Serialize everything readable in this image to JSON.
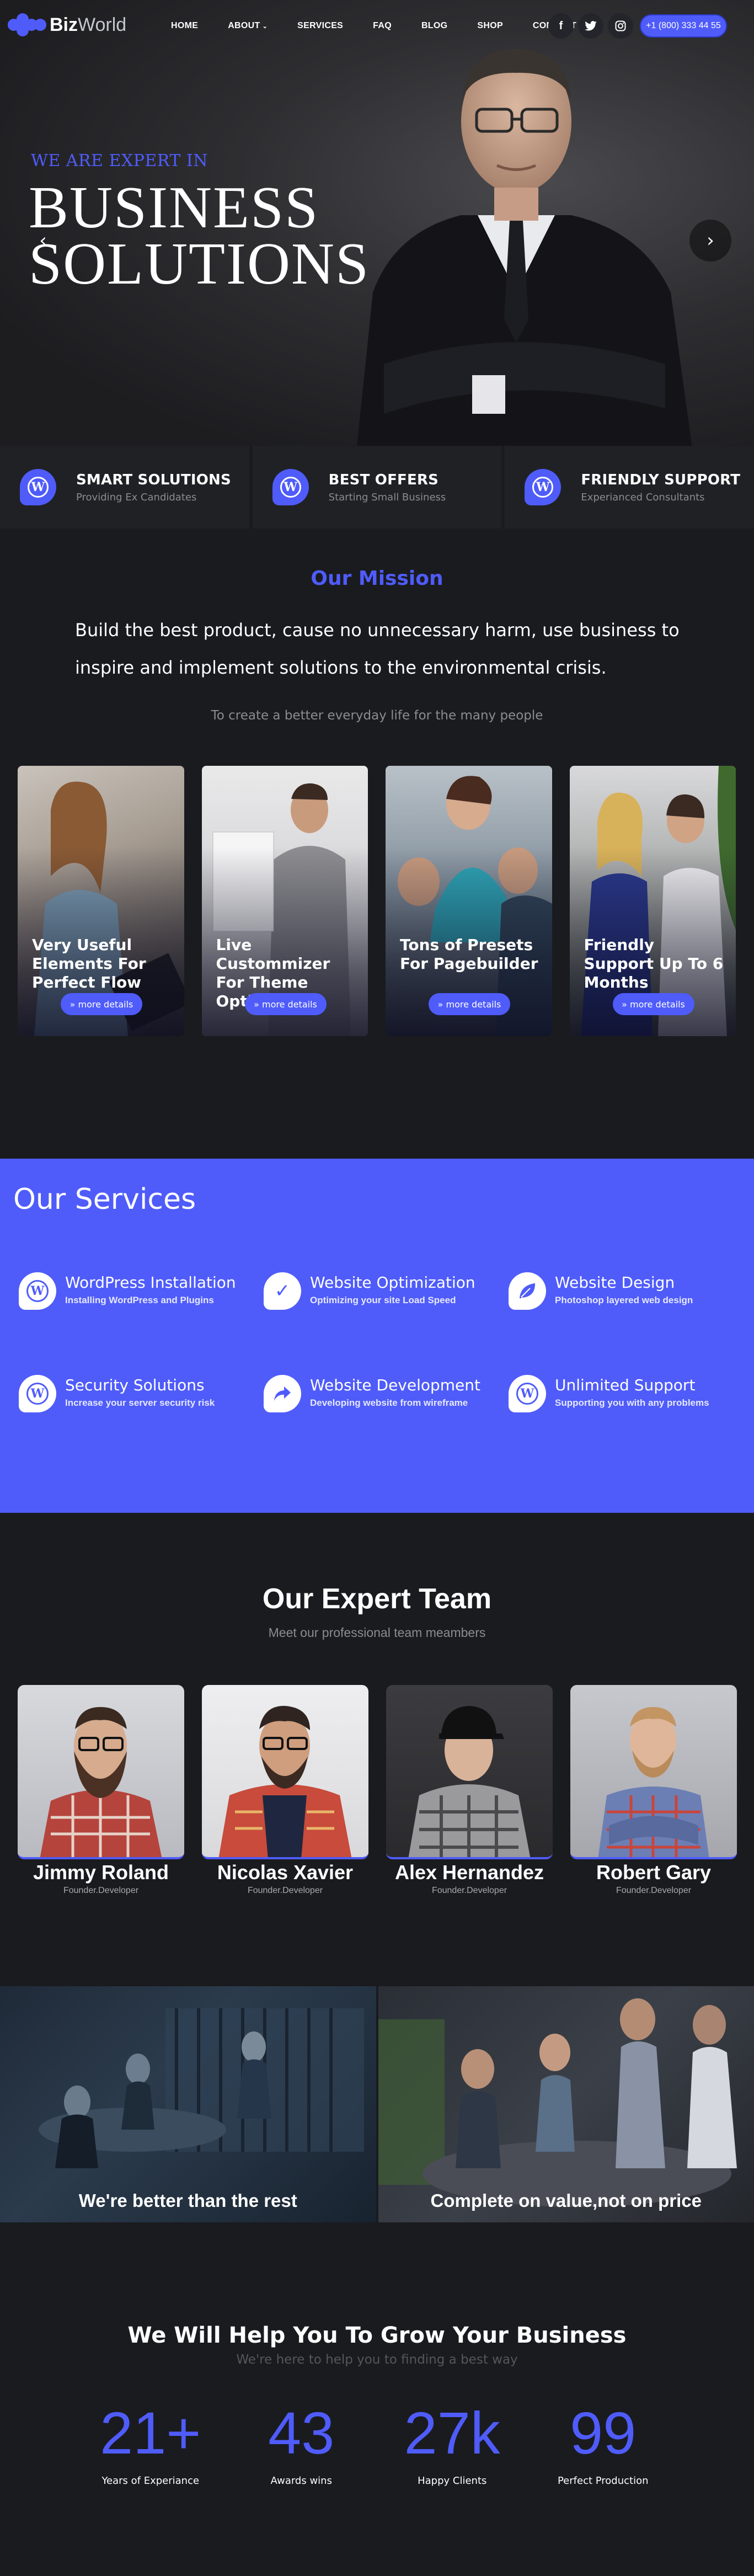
{
  "brand": {
    "name_bold": "Biz",
    "name_light": "World",
    "accent_color": "#4f5cfa"
  },
  "nav": {
    "items": [
      {
        "label": "HOME"
      },
      {
        "label": "ABOUT",
        "has_dropdown": true
      },
      {
        "label": "SERVICES"
      },
      {
        "label": "FAQ"
      },
      {
        "label": "BLOG"
      },
      {
        "label": "SHOP"
      },
      {
        "label": "CONTACT"
      }
    ],
    "social": [
      {
        "icon": "facebook-icon",
        "glyph": "f"
      },
      {
        "icon": "twitter-icon",
        "glyph": "🐦"
      },
      {
        "icon": "instagram-icon",
        "glyph": "◎"
      }
    ],
    "phone": "+1 (800) 333 44 55"
  },
  "hero": {
    "kicker": "WE ARE EXPERT IN",
    "title_line1": "BUSINESS",
    "title_line2": "SOLUTIONS",
    "prev_arrow": "‹",
    "next_arrow": "›"
  },
  "features": [
    {
      "title": "SMART SOLUTIONS",
      "subtitle": "Providing Ex Candidates",
      "icon": "wordpress-icon"
    },
    {
      "title": "BEST OFFERS",
      "subtitle": "Starting Small Business",
      "icon": "wordpress-icon"
    },
    {
      "title": "FRIENDLY SUPPORT",
      "subtitle": "Experianced Consultants",
      "icon": "wordpress-icon"
    }
  ],
  "mission": {
    "title": "Our Mission",
    "text": "Build the best product, cause no unnecessary harm, use business to inspire and implement solutions to the environmental crisis.",
    "subtitle": "To create a better everyday life for the many people"
  },
  "cards": [
    {
      "title": "Very Useful Elements For Perfect Flow",
      "button": "» more details"
    },
    {
      "title": "Live Custommizer For Theme Option",
      "button": "» more details"
    },
    {
      "title": "Tons of Presets For Pagebuilder",
      "button": "» more details"
    },
    {
      "title": "Friendly Support Up To 6 Months",
      "button": "» more details"
    }
  ],
  "services": {
    "title": "Our Services",
    "items": [
      {
        "title": "WordPress Installation",
        "subtitle": "Installing WordPress and Plugins",
        "icon": "wordpress-icon"
      },
      {
        "title": "Website Optimization",
        "subtitle": "Optimizing your site Load Speed",
        "icon": "check-icon"
      },
      {
        "title": "Website Design",
        "subtitle": "Photoshop layered web design",
        "icon": "leaf-icon"
      },
      {
        "title": "Security Solutions",
        "subtitle": "Increase your server security risk",
        "icon": "wordpress-icon"
      },
      {
        "title": "Website Development",
        "subtitle": "Developing website from wireframe",
        "icon": "share-arrow-icon"
      },
      {
        "title": "Unlimited Support",
        "subtitle": "Supporting you with any problems",
        "icon": "wordpress-icon"
      }
    ]
  },
  "team": {
    "title": "Our Expert Team",
    "subtitle": "Meet our professional team meambers",
    "members": [
      {
        "name": "Jimmy Roland",
        "role": "Founder.Developer"
      },
      {
        "name": "Nicolas Xavier",
        "role": "Founder.Developer"
      },
      {
        "name": "Alex Hernandez",
        "role": "Founder.Developer"
      },
      {
        "name": "Robert Gary",
        "role": "Founder.Developer"
      }
    ]
  },
  "banners": [
    {
      "title": "We're better than the rest"
    },
    {
      "title": "Complete on value,not on price"
    }
  ],
  "grow": {
    "title": "We Will Help You To Grow Your Business",
    "subtitle": "We're here to help you to finding a best way",
    "stats": [
      {
        "value": "21+",
        "label": "Years of Experiance"
      },
      {
        "value": "43",
        "label": "Awards wins"
      },
      {
        "value": "27k",
        "label": "Happy Clients"
      },
      {
        "value": "99",
        "label": "Perfect Production"
      }
    ]
  }
}
